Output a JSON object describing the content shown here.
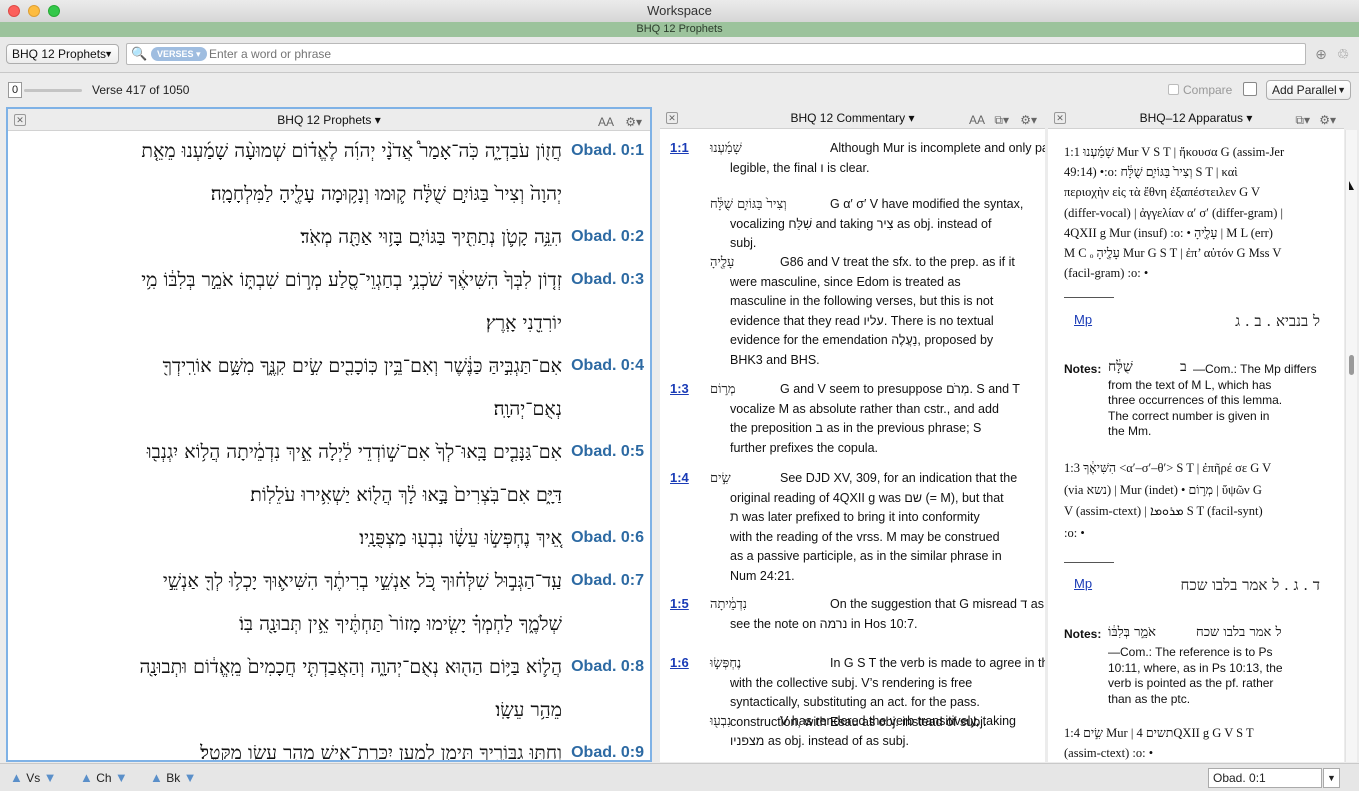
{
  "window": {
    "title": "Workspace",
    "subtitle": "BHQ 12 Prophets"
  },
  "toolbar": {
    "resource": "BHQ 12 Prophets",
    "scope_pill": "VERSES",
    "search_placeholder": "Enter a word or phrase"
  },
  "navbar": {
    "position_value": "0",
    "verse_position": "Verse 417 of 1050",
    "compare_label": "Compare",
    "add_parallel_label": "Add Parallel"
  },
  "panes": {
    "text": {
      "title": "BHQ 12 Prophets"
    },
    "commentary": {
      "title": "BHQ 12 Commentary"
    },
    "apparatus": {
      "title": "BHQ–12 Apparatus"
    }
  },
  "font_tool": "AA",
  "bible": {
    "lines": [
      {
        "ref": "Obad. 0:1",
        "hebrew": "חֲז֖וֹן עֹבַדְיָ֑ה כֹּֽה־אָמַר֩ אֲדֹנָ֨י יְהוִ֜ה לֶאֱד֗וֹם שְׁמוּעָ֨ה שָׁמַ֜עְנוּ מֵאֵ֤ת"
      },
      {
        "ref": "",
        "hebrew": "יְהוָה֙ וְצִיר֙ בַּגּוֹיִ֣ם שֻׁלָּ֔ח ק֛וּמוּ וְנָק֥וּמָה עָלֶ֖יהָ לַמִּלְחָמָֽה׃"
      },
      {
        "ref": "Obad. 0:2",
        "hebrew": "הִנֵּ֥ה קָטֹ֛ן נְתַתִּ֖יךָ בַּגּוֹיִ֑ם בָּז֥וּי אַתָּ֖ה מְאֹֽד׃"
      },
      {
        "ref": "Obad. 0:3",
        "hebrew": "זְד֤וֹן לִבְּךָ֙ הִשִּׁיאֶ֔ךָ שֹׁכְנִ֥י בְחַגְוֵי־סֶ֖לַע מְר֣וֹם שִׁבְתּ֑וֹ אֹמֵ֣ר בְּלִבּ֔וֹ מִ֥י"
      },
      {
        "ref": "",
        "hebrew": "יוֹרִדֵ֖נִי אָֽרֶץ׃"
      },
      {
        "ref": "Obad. 0:4",
        "hebrew": "אִם־תַּגְבִּ֣יהַּ כַּנֶּ֔שֶׁר וְאִם־בֵּ֥ין כּֽוֹכָבִ֖ים שִׂ֣ים קִנֶּ֑ךָ מִשָּׁ֥ם אוֹרִֽידְךָ֖"
      },
      {
        "ref": "",
        "hebrew": "נְאֻם־יְהוָֽה׃"
      },
      {
        "ref": "Obad. 0:5",
        "hebrew": "אִם־גַּנָּבִ֤ים בָּֽאוּ־לְךָ֙ אִם־שׁ֣וֹדְדֵי לַ֔יְלָה אֵ֣יךְ נִדְמֵ֔יתָה הֲל֥וֹא יִגְנְב֖וּ"
      },
      {
        "ref": "",
        "hebrew": "דַּיָּ֑ם אִם־בֹּֽצְרִים֙ בָּ֣אוּ לָ֔ךְ הֲל֖וֹא יַשְׁאִ֥ירוּ עֹלֵלֽוֹת׃"
      },
      {
        "ref": "Obad. 0:6",
        "hebrew": "אֵ֚יךְ נֶחְפְּשׂ֣וּ עֵשָׂ֔ו נִבְע֖וּ מַצְפֻּנָֽיו׃"
      },
      {
        "ref": "Obad. 0:7",
        "hebrew": "עַֽד־הַגְּב֣וּל שִׁלְּח֗וּךָ כֹּ֚ל אַנְשֵׁ֣י בְרִיתֶ֔ךָ הִשִּׁיא֛וּךָ יָכְל֥וּ לְךָ֖ אַנְשֵׁ֣י"
      },
      {
        "ref": "",
        "hebrew": "שְׁלֹמֶ֑ךָ לַחְמְךָ֗ יָשִׂ֤ימוּ מָזוֹר֙ תַּחְתֶּ֔יךָ אֵ֥ין תְּבוּנָ֖ה בּֽוֹ׃"
      },
      {
        "ref": "Obad. 0:8",
        "hebrew": "הֲל֛וֹא בַּיּ֥וֹם הַה֖וּא נְאֻם־יְהוָ֑ה וְהַאֲבַדְתִּ֤י חֲכָמִים֙ מֵֽאֱד֔וֹם וּתְבוּנָ֖ה"
      },
      {
        "ref": "",
        "hebrew": "מֵהַ֥ר עֵשָֽׂו׃"
      },
      {
        "ref": "Obad. 0:9",
        "hebrew": "וְחַתּ֥וּ גִבּוֹרֶ֖יךָ תֵּימָ֑ן לְמַ֧עַן יִכָּֽרֶת־אִ֛ישׁ מֵהַ֥ר עֵשָׂ֖ו מִקָּֽטֶל׃"
      }
    ]
  },
  "commentary": {
    "entries": [
      {
        "ref": "1:1",
        "lemma": "שָׁמַ֜עְנוּ",
        "lines": [
          "Although Mur is incomplete and only partially",
          "legible, the final ו is clear."
        ]
      },
      {
        "ref": "",
        "lemma": "וְצִיר֙ בַּגּוֹיִ֣ם שֻׁלָּ֔ח",
        "lines": [
          "G α′ σ′ V have modified the syntax,",
          "vocalizing שִׁלַּח and taking צִיר as obj. instead of",
          "subj."
        ]
      },
      {
        "ref": "",
        "lemma": "עָלֶ֖יהָ",
        "lines": [
          "G86 and V treat the sfx. to the prep. as if it",
          "were masculine, since Edom is treated as",
          "masculine in the following verses, but this is not",
          "evidence that they read עליו. There is no textual",
          "evidence for the emendation נַעֲלֶה, proposed by",
          "BHK3 and BHS."
        ]
      },
      {
        "ref": "1:3",
        "lemma": "מְר֣וֹם",
        "lines": [
          "G and V seem to presuppose מְרֹם. S and T",
          "vocalize M as absolute rather than cstr., and add",
          "the preposition ב as in the previous phrase; S",
          "further prefixes the copula."
        ]
      },
      {
        "ref": "1:4",
        "lemma": "שִׂ֣ים",
        "lines": [
          "See DJD XV, 309, for an indication that the",
          "original reading of 4QXII g was שם (= M), but that",
          "ת was later prefixed to bring it into conformity",
          "with the reading of the vrss. M may be construed",
          "as a passive participle, as in the similar phrase in",
          "Num 24:21."
        ]
      },
      {
        "ref": "1:5",
        "lemma": "נִדְמֵ֔יתָה",
        "lines": [
          "On the suggestion that G misread ד as ר,",
          "see the note on נרמה in Hos 10:7."
        ]
      },
      {
        "ref": "1:6",
        "lemma": "נֶחְפְּשׂ֣וּ",
        "lines": [
          "In G S T the verb is made to agree in the sg.",
          "with the collective subj. V’s rendering is free",
          "syntactically, substituting an act. for the pass.",
          "construction, with Esau as obj. instead of subj."
        ]
      },
      {
        "ref": "",
        "lemma": "נִבְע֖וּ",
        "lines": [
          "V has rendered the verb transitively, taking",
          "מצפניו as obj. instead of as subj."
        ]
      }
    ]
  },
  "apparatus": {
    "lines": [
      "1:1 שָׁמַ֜עְנוּ Mur V S T | ἤκουσα G (assim-Jer",
      "49:14) •:o: וְצִיר֙ בַּגּוֹיִ֣ם שֻׁלָּ֔ח S T | καὶ",
      "περιοχὴν εἰς τὰ ἔθνη ἐξαπέστειλεν G V",
      "(differ-vocal) | ἀγγελίαν α′ σ′ (differ-gram) |",
      "4QXII g Mur (insuf) :o: • עָלֶ֖יהָ | M L (err)",
      "M C ₒ עָלֶ֖יהָ Mur G S T | ἐπ’ αὐτόν G Mss V",
      "(facil-gram) :o: •"
    ],
    "mp1": {
      "label": "Mp",
      "hebrew": "ל בנביא . ב . ג"
    },
    "notes1": {
      "label": "Notes:",
      "lemma": "שֻׁלָּ֔ח",
      "marker": "ב",
      "lines": [
        "—Com.: The Mp differs",
        "from the text of M L, which has",
        "three occurrences of this lemma.",
        "The correct number is given in",
        "the Mm."
      ]
    },
    "lines2": [
      "1:3 הִשִּׁיאֶ֔ךָ <α′–σ′–θ′> S T | ἐπῆρέ σε G V",
      "(via נשא) | Mur (indet) • מְר֣וֹם | ὕψῶν G",
      "V (assim-ctext) | ܡܪܘܡܐ S T (facil-synt)",
      ":o: •"
    ],
    "mp2": {
      "label": "Mp",
      "hebrew": "ד . ג . ל אמר בלבו שכח"
    },
    "notes2": {
      "label": "Notes:",
      "lemma": "אֹמֵ֣ר בְּלִבּ֔וֹ",
      "marker": "ל אמר בלבו שכח",
      "lines": [
        "—Com.: The reference is to Ps",
        "10:11, where, as in Ps 10:13, the",
        "verb is pointed as the pf. rather",
        "than as the ptc."
      ]
    },
    "lines3": [
      "1:4 שִׂ֣ים Mur | תשים 4QXII g G V S T",
      "(assim-ctext) :o: •"
    ]
  },
  "statusbar": {
    "vs": "Vs",
    "ch": "Ch",
    "bk": "Bk",
    "reference": "Obad. 0:1"
  }
}
